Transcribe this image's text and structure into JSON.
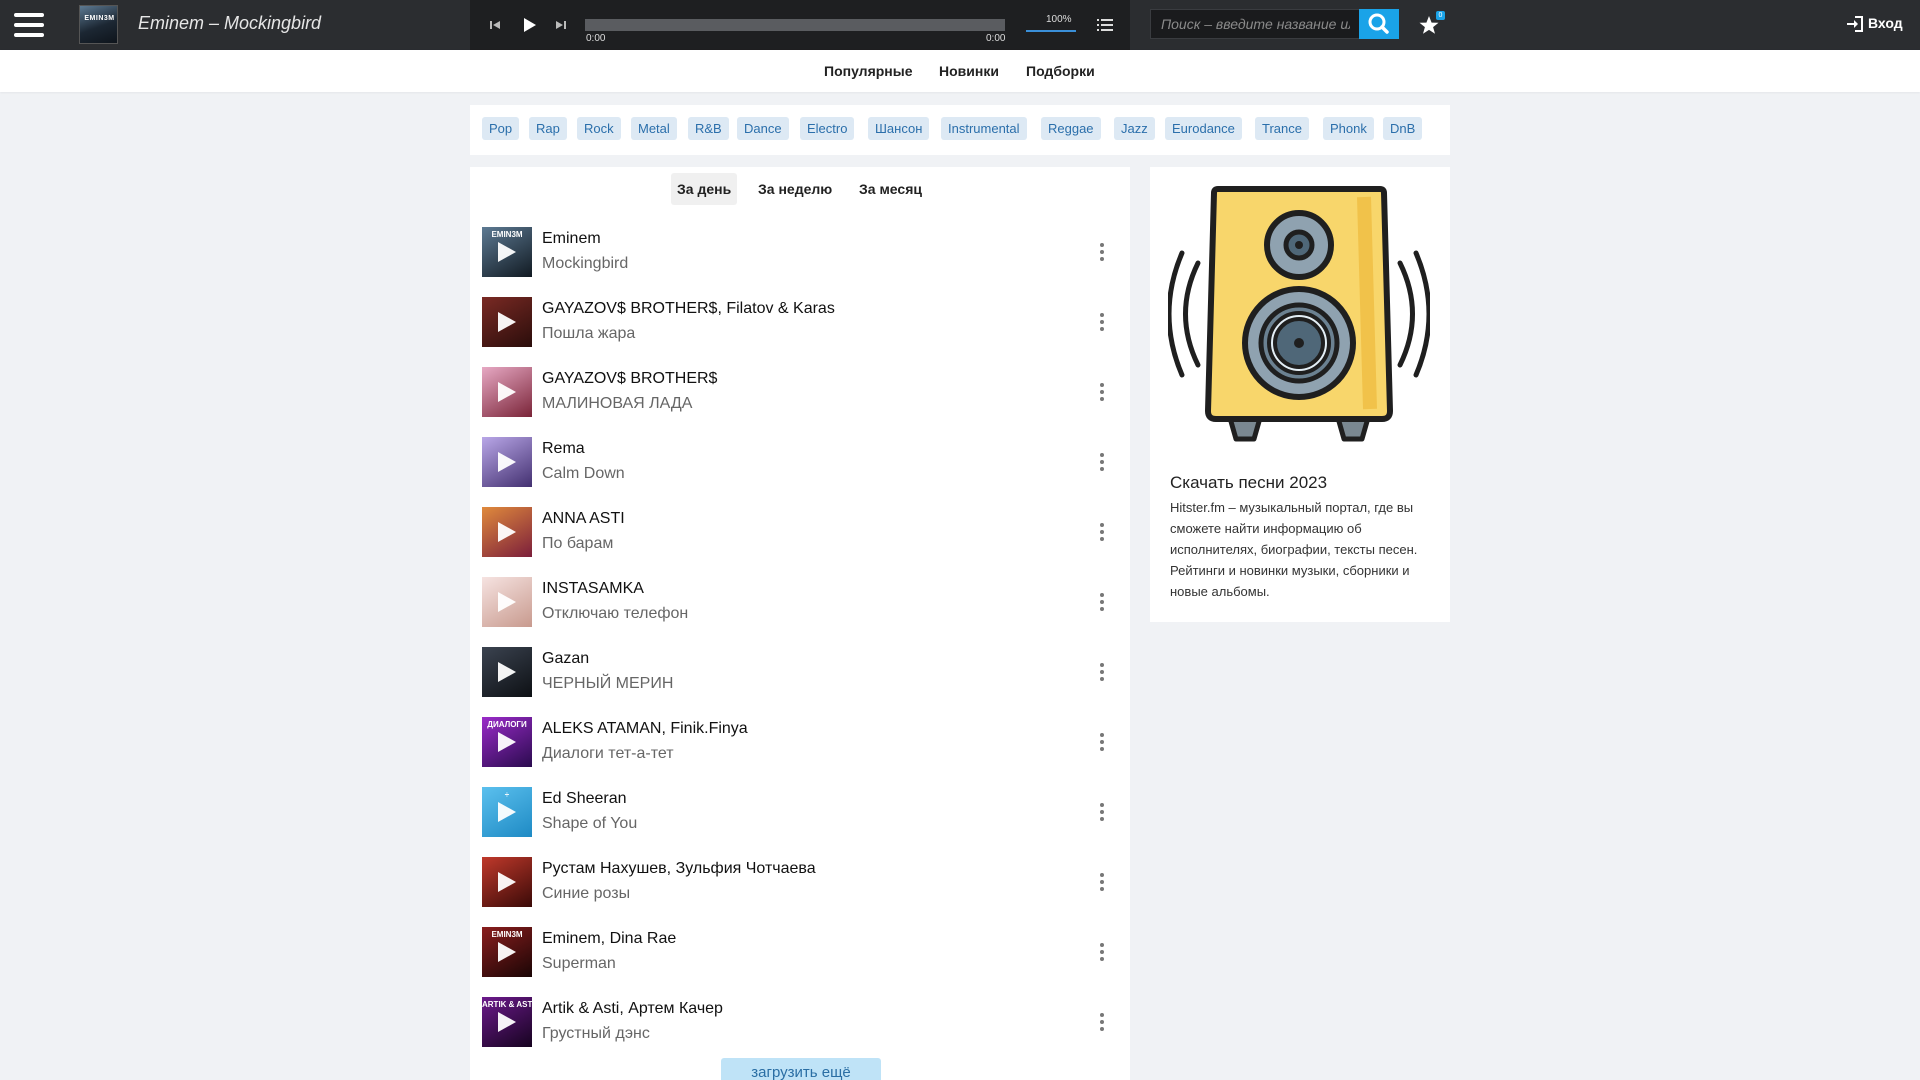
{
  "header": {
    "now_playing": "Eminem – Mockingbird",
    "now_cover_text": "EMIN3M",
    "time_current": "0:00",
    "time_total": "0:00",
    "volume": "100%",
    "volume_level": 1.0,
    "progress_level": 0.0,
    "search_placeholder": "Поиск – введите название или исполнителя",
    "favorites_count": "0",
    "login_label": "Вход",
    "accent_color": "#1aa3e8",
    "icons": [
      "menu-icon",
      "prev-icon",
      "play-icon",
      "next-icon",
      "playlist-icon",
      "search-icon",
      "star-icon",
      "login-icon"
    ]
  },
  "subnav": {
    "popular": "Популярные",
    "new": "Новинки",
    "collections": "Подборки"
  },
  "genres": [
    "Pop",
    "Rap",
    "Rock",
    "Metal",
    "R&B",
    "Dance",
    "Electro",
    "Шансон",
    "Instrumental",
    "Reggae",
    "Jazz",
    "Eurodance",
    "Trance",
    "Phonk",
    "DnB"
  ],
  "periods": {
    "day": "За день",
    "week": "За неделю",
    "month": "За месяц",
    "active": "day"
  },
  "tracks": [
    {
      "artist": "Eminem",
      "title": "Mockingbird",
      "color_a": "#5d7a93",
      "color_b": "#111a22",
      "cover_text": "EMIN3M"
    },
    {
      "artist": "GAYAZOV$ BROTHER$, Filatov & Karas",
      "title": "Пошла жара",
      "color_a": "#7a2a24",
      "color_b": "#2a0d0b",
      "cover_text": ""
    },
    {
      "artist": "GAYAZOV$ BROTHER$",
      "title": "МАЛИНОВАЯ ЛАДА",
      "color_a": "#e7a9c4",
      "color_b": "#7a2438",
      "cover_text": ""
    },
    {
      "artist": "Rema",
      "title": "Calm Down",
      "color_a": "#b9a7e8",
      "color_b": "#433070",
      "cover_text": ""
    },
    {
      "artist": "ANNA ASTI",
      "title": "По барам",
      "color_a": "#e08a3c",
      "color_b": "#7b1e3b",
      "cover_text": ""
    },
    {
      "artist": "INSTASAMKA",
      "title": "Отключаю телефон",
      "color_a": "#f6e3e1",
      "color_b": "#c89a8e",
      "cover_text": ""
    },
    {
      "artist": "Gazan",
      "title": "ЧЕРНЫЙ МЕРИН",
      "color_a": "#3b4350",
      "color_b": "#0d1014",
      "cover_text": ""
    },
    {
      "artist": "ALEKS ATAMAN, Finik.Finya",
      "title": "Диалоги тет-а-тет",
      "color_a": "#9a2bc9",
      "color_b": "#2a0b4e",
      "cover_text": "ДИАЛОГИ"
    },
    {
      "artist": "Ed Sheeran",
      "title": "Shape of You",
      "color_a": "#5bc0ee",
      "color_b": "#1e8ac4",
      "cover_text": "÷"
    },
    {
      "artist": "Рустам Нахушев, Зульфия Чотчаева",
      "title": "Синие розы",
      "color_a": "#c0392b",
      "color_b": "#3a0a08",
      "cover_text": ""
    },
    {
      "artist": "Eminem, Dina Rae",
      "title": "Superman",
      "color_a": "#8a1e1e",
      "color_b": "#1a0505",
      "cover_text": "EMIN3M"
    },
    {
      "artist": "Artik & Asti, Артем Качер",
      "title": "Грустный дэнс",
      "color_a": "#6c1a8c",
      "color_b": "#16031f",
      "cover_text": "ARTIK & ASTI"
    }
  ],
  "load_more": "загрузить ещё",
  "sidebar": {
    "heading": "Скачать песни 2023",
    "text": "Hitster.fm – музыкальный портал, где вы сможете найти информацию об исполнителях, биографии, тексты песен. Рейтинги и новинки музыки, сборники и новые альбомы."
  }
}
